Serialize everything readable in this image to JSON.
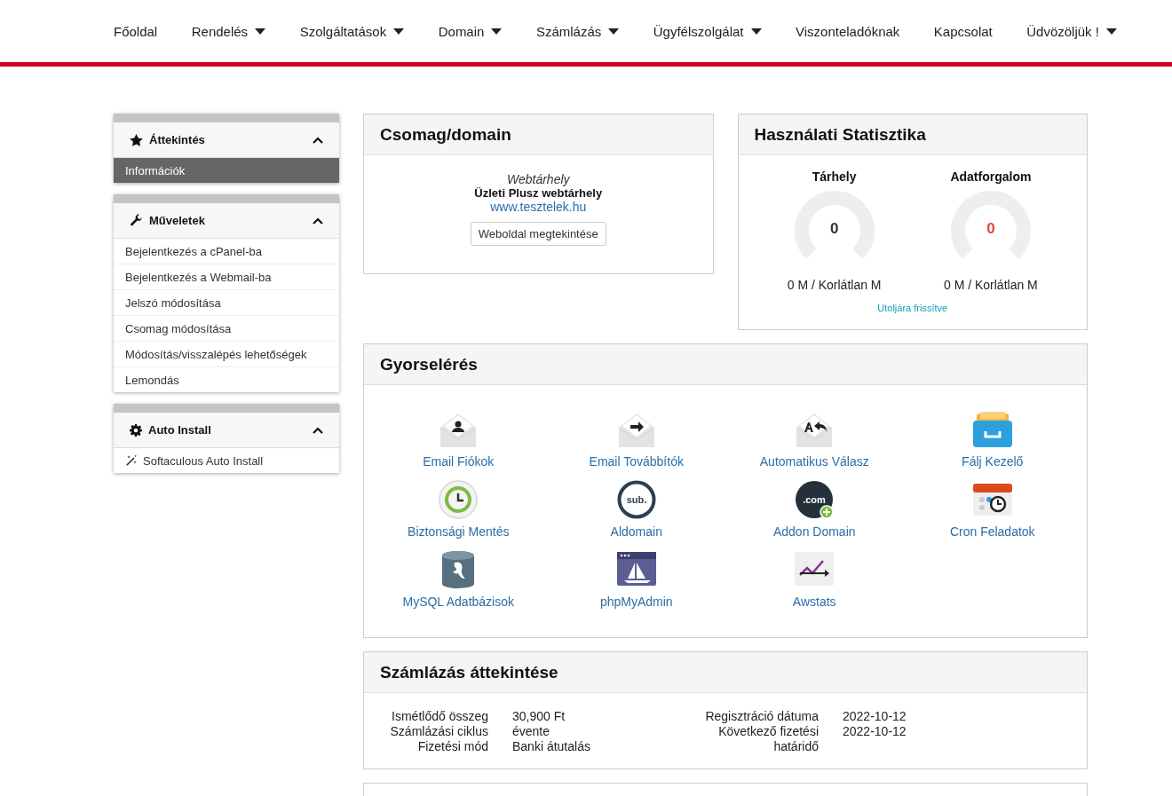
{
  "nav": [
    {
      "label": "Főoldal",
      "dropdown": false
    },
    {
      "label": "Rendelés",
      "dropdown": true
    },
    {
      "label": "Szolgáltatások",
      "dropdown": true
    },
    {
      "label": "Domain",
      "dropdown": true
    },
    {
      "label": "Számlázás",
      "dropdown": true
    },
    {
      "label": "Ügyfélszolgálat",
      "dropdown": true
    },
    {
      "label": "Viszonteladóknak",
      "dropdown": false
    },
    {
      "label": "Kapcsolat",
      "dropdown": false
    },
    {
      "label": "Üdvözöljük !",
      "dropdown": true
    }
  ],
  "sidebar": [
    {
      "title": "Áttekintés",
      "expanded": true,
      "items": [
        {
          "label": "Információk",
          "selected": true
        }
      ]
    },
    {
      "title": "Műveletek",
      "expanded": true,
      "items": [
        {
          "label": "Bejelentkezés a cPanel-ba",
          "selected": false
        },
        {
          "label": "Bejelentkezés a Webmail-ba",
          "selected": false
        },
        {
          "label": "Jelszó módosítása",
          "selected": false
        },
        {
          "label": "Csomag módosítása",
          "selected": false
        },
        {
          "label": "Módosítás/visszalépés lehetőségek",
          "selected": false
        },
        {
          "label": "Lemondás",
          "selected": false
        }
      ]
    },
    {
      "title": "Auto Install",
      "expanded": true,
      "items": [
        {
          "label": "Softaculous Auto Install",
          "selected": false
        }
      ]
    }
  ],
  "package": {
    "title": "Csomag/domain",
    "type": "Webtárhely",
    "name": "Üzleti Plusz webtárhely",
    "domain": "www.tesztelek.hu",
    "button": "Weboldal megtekintése"
  },
  "usage": {
    "title": "Használati Statisztika",
    "gauges": [
      {
        "label": "Tárhely",
        "value": "0",
        "level": 0,
        "color": "#333333",
        "reading": "0 M / Korlátlan M"
      },
      {
        "label": "Adatforgalom",
        "value": "0",
        "level": 0,
        "color": "#e04848",
        "reading": "0 M / Korlátlan M"
      }
    ],
    "refresh": "Utoljára frissítve"
  },
  "quick": {
    "title": "Gyorselérés",
    "items": [
      {
        "label": "Email Fiókok"
      },
      {
        "label": "Email Továbbítók"
      },
      {
        "label": "Automatikus Válasz"
      },
      {
        "label": "Fálj Kezelő"
      },
      {
        "label": "Biztonsági Mentés"
      },
      {
        "label": "Aldomain",
        "icon_text": "sub."
      },
      {
        "label": "Addon Domain",
        "icon_text": ".com"
      },
      {
        "label": "Cron Feladatok"
      },
      {
        "label": "MySQL Adatbázisok"
      },
      {
        "label": "phpMyAdmin"
      },
      {
        "label": "Awstats"
      }
    ]
  },
  "billing": {
    "title": "Számlázás áttekintése",
    "left": [
      {
        "label": "Ismétlődő összeg",
        "value": "30,900 Ft"
      },
      {
        "label": "Számlázási ciklus",
        "value": "évente"
      },
      {
        "label": "Fizetési mód",
        "value": "Banki átutalás"
      }
    ],
    "right": [
      {
        "label": "Regisztráció dátuma",
        "value": "2022-10-12"
      },
      {
        "label": "Következő fizetési határidő",
        "value": "2022-10-12"
      }
    ]
  }
}
